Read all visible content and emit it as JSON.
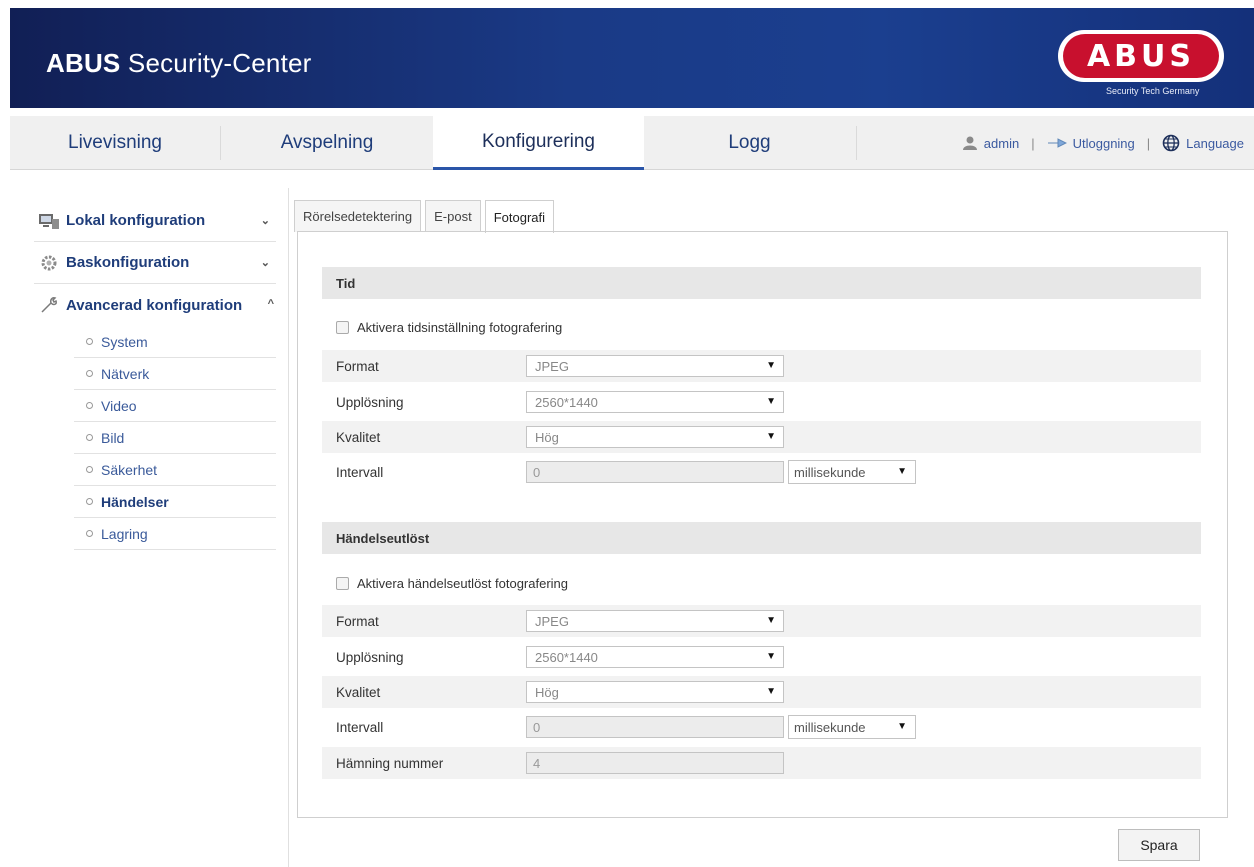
{
  "header": {
    "title_bold": "ABUS",
    "title_rest": " Security-Center",
    "logo_text": "ABUS",
    "logo_tagline": "Security Tech Germany"
  },
  "topnav": {
    "tabs": [
      {
        "label": "Livevisning",
        "active": false
      },
      {
        "label": "Avspelning",
        "active": false
      },
      {
        "label": "Konfigurering",
        "active": true
      },
      {
        "label": "Logg",
        "active": false
      }
    ],
    "user": "admin",
    "logout": "Utloggning",
    "language": "Language"
  },
  "sidebar": {
    "groups": [
      {
        "label": "Lokal konfiguration",
        "icon": "monitor-icon",
        "expanded": false
      },
      {
        "label": "Baskonfiguration",
        "icon": "gear-icon",
        "expanded": false
      },
      {
        "label": "Avancerad konfiguration",
        "icon": "wrench-icon",
        "expanded": true
      }
    ],
    "sub_items": [
      "System",
      "Nätverk",
      "Video",
      "Bild",
      "Säkerhet",
      "Händelser",
      "Lagring"
    ],
    "active_sub": "Händelser"
  },
  "content_tabs": [
    {
      "label": "Rörelsedetektering",
      "active": false
    },
    {
      "label": "E-post",
      "active": false
    },
    {
      "label": "Fotografi",
      "active": true
    }
  ],
  "tid": {
    "heading": "Tid",
    "checkbox_label": "Aktivera tidsinställning fotografering",
    "format_label": "Format",
    "format_value": "JPEG",
    "resolution_label": "Upplösning",
    "resolution_value": "2560*1440",
    "quality_label": "Kvalitet",
    "quality_value": "Hög",
    "interval_label": "Intervall",
    "interval_value": "0",
    "interval_unit": "millisekunde"
  },
  "event": {
    "heading": "Händelseutlöst",
    "checkbox_label": "Aktivera händelseutlöst fotografering",
    "format_label": "Format",
    "format_value": "JPEG",
    "resolution_label": "Upplösning",
    "resolution_value": "2560*1440",
    "quality_label": "Kvalitet",
    "quality_value": "Hög",
    "interval_label": "Intervall",
    "interval_value": "0",
    "interval_unit": "millisekunde",
    "capture_count_label": "Hämning nummer",
    "capture_count_value": "4"
  },
  "save_label": "Spara",
  "colors": {
    "header_bg": "#1a3a86",
    "link_blue": "#1f3d7a",
    "logo_red": "#c8102e"
  }
}
